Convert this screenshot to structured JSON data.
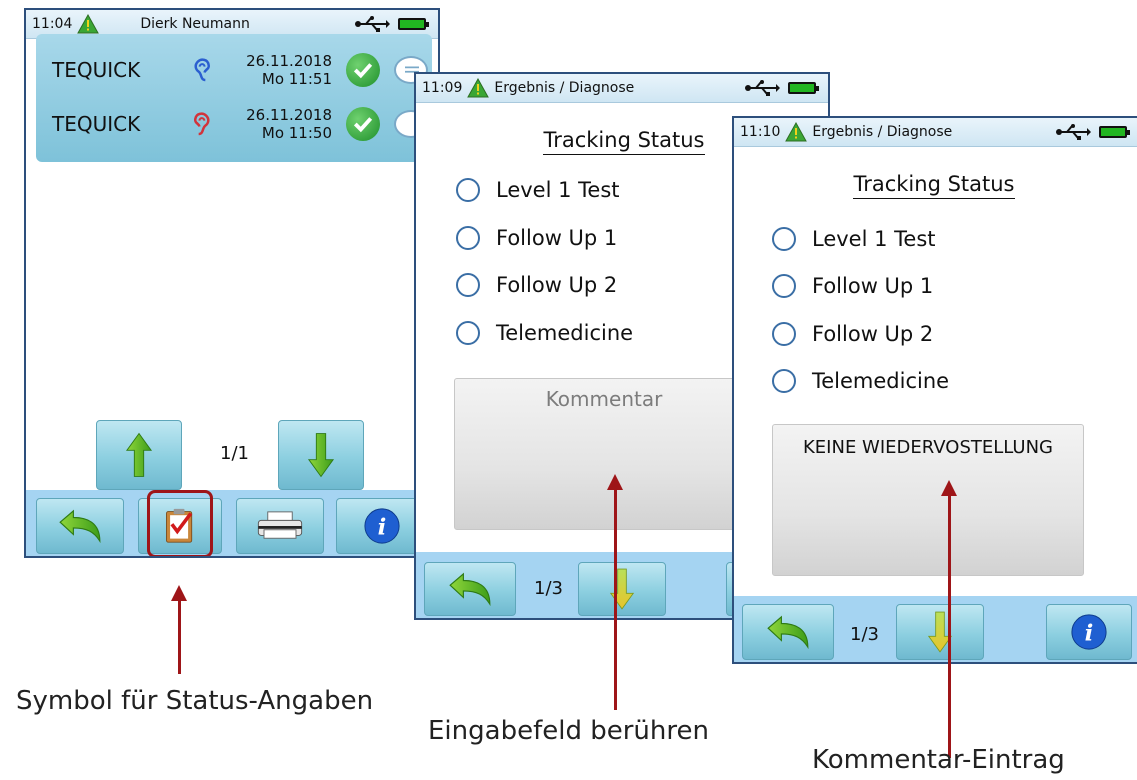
{
  "screen1": {
    "time": "11:04",
    "user": "Dierk Neumann",
    "rows": [
      {
        "name": "TEQUICK",
        "date": "26.11.2018",
        "day_time": "Mo  11:51",
        "ear": "right"
      },
      {
        "name": "TEQUICK",
        "date": "26.11.2018",
        "day_time": "Mo  11:50",
        "ear": "left"
      }
    ],
    "page": "1/1"
  },
  "screen2": {
    "time": "11:09",
    "title": "Ergebnis / Diagnose",
    "tracking_title": "Tracking Status",
    "options": [
      "Level 1 Test",
      "Follow Up 1",
      "Follow Up 2",
      "Telemedicine"
    ],
    "comment_placeholder": "Kommentar",
    "page": "1/3"
  },
  "screen3": {
    "time": "11:10",
    "title": "Ergebnis / Diagnose",
    "tracking_title": "Tracking Status",
    "options": [
      "Level 1 Test",
      "Follow Up 1",
      "Follow Up 2",
      "Telemedicine"
    ],
    "comment_value": "KEINE WIEDERVOSTELLUNG",
    "page": "1/3"
  },
  "captions": {
    "status_symbol": "Symbol für Status-Angaben",
    "touch_field": "Eingabefeld berühren",
    "comment_entry": "Kommentar-Eintrag"
  },
  "colors": {
    "accent_blue": "#2d4f7c",
    "arrow_red": "#9e1518",
    "button_teal": "#8ccfe0",
    "bar_blue": "#a5d4f2"
  },
  "icons": [
    "warning-icon",
    "usb-icon",
    "battery-icon",
    "ear-right-icon",
    "ear-left-icon",
    "check-icon",
    "comment-bubble-icon",
    "arrow-up-icon",
    "arrow-down-icon",
    "back-icon",
    "status-clipboard-icon",
    "printer-icon",
    "info-icon"
  ]
}
